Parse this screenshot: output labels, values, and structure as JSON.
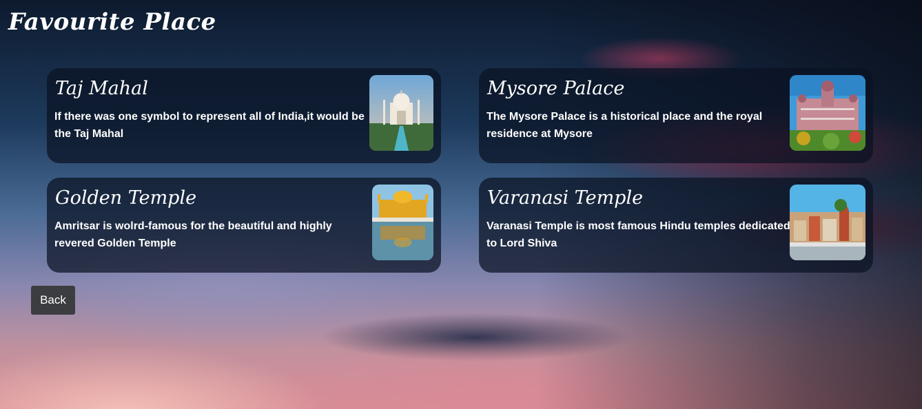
{
  "page": {
    "title": "Favourite Place"
  },
  "places": [
    {
      "name": "Taj Mahal",
      "description": "If there was one symbol to represent all of India,it would be the Taj Mahal",
      "image_icon": "taj-mahal-photo"
    },
    {
      "name": "Mysore Palace",
      "description": "The Mysore Palace is a historical place and the royal residence at Mysore",
      "image_icon": "mysore-palace-photo"
    },
    {
      "name": "Golden Temple",
      "description": "Amritsar is wolrd-famous for the beautiful and highly revered Golden Temple",
      "image_icon": "golden-temple-photo"
    },
    {
      "name": "Varanasi Temple",
      "description": "Varanasi Temple is most famous Hindu temples dedicated to Lord Shiva",
      "image_icon": "varanasi-temple-photo"
    }
  ],
  "actions": {
    "back_label": "Back"
  },
  "colors": {
    "card_background": "#0a1223",
    "button_background": "#3b3d40",
    "text": "#ffffff"
  }
}
